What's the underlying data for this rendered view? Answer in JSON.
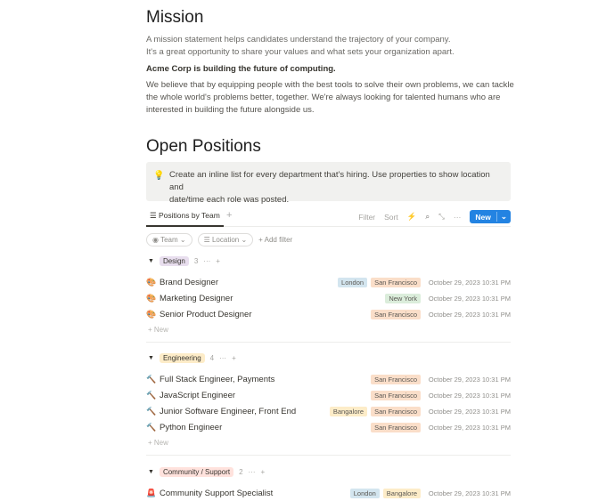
{
  "mission": {
    "title": "Mission",
    "intro": [
      "A mission statement helps candidates understand the trajectory of your company.",
      "It's a great opportunity to share your values and what sets your organization apart."
    ],
    "bold": "Acme Corp is building the future of computing.",
    "body": [
      "We believe that by equipping people with the best tools to solve their own problems, we can tackle",
      "the whole world's problems better, together. We're always looking for talented humans who are",
      "interested in building the future alongside us."
    ]
  },
  "positions": {
    "title": "Open Positions",
    "callout": [
      "Create an inline list for every department that's hiring. Use properties to show location and",
      "date/time each role was posted."
    ],
    "callout_icon": "lightbulb-icon"
  },
  "view": {
    "tab": "Positions by Team",
    "filter": "Filter",
    "sort": "Sort",
    "new": "New",
    "filters": {
      "team": "Team",
      "location": "Location",
      "add": "Add filter"
    }
  },
  "colors": {
    "London": "#d3e5ef",
    "San Francisco": "#fadec9",
    "New York": "#dbeddb",
    "Bangalore": "#fdecc8",
    "Design": "#e8deee",
    "Engineering": "#fdecc8",
    "Community / Support": "#ffe2dd"
  },
  "groups": [
    {
      "name": "Design",
      "count": "3",
      "icon": "🎨",
      "rows": [
        {
          "name": "Brand Designer",
          "tags": [
            "London",
            "San Francisco"
          ],
          "date": "October 29, 2023 10:31 PM"
        },
        {
          "name": "Marketing Designer",
          "tags": [
            "New York"
          ],
          "date": "October 29, 2023 10:31 PM"
        },
        {
          "name": "Senior Product Designer",
          "tags": [
            "San Francisco"
          ],
          "date": "October 29, 2023 10:31 PM"
        }
      ]
    },
    {
      "name": "Engineering",
      "count": "4",
      "icon": "🔨",
      "rows": [
        {
          "name": "Full Stack Engineer, Payments",
          "tags": [
            "San Francisco"
          ],
          "date": "October 29, 2023 10:31 PM"
        },
        {
          "name": "JavaScript Engineer",
          "tags": [
            "San Francisco"
          ],
          "date": "October 29, 2023 10:31 PM"
        },
        {
          "name": "Junior Software Engineer, Front End",
          "tags": [
            "Bangalore",
            "San Francisco"
          ],
          "date": "October 29, 2023 10:31 PM"
        },
        {
          "name": "Python Engineer",
          "tags": [
            "San Francisco"
          ],
          "date": "October 29, 2023 10:31 PM"
        }
      ]
    },
    {
      "name": "Community / Support",
      "count": "2",
      "icon": "🚨",
      "rows": [
        {
          "name": "Community Support Specialist",
          "tags": [
            "London",
            "Bangalore"
          ],
          "date": "October 29, 2023 10:31 PM"
        }
      ]
    }
  ],
  "new_label": "New"
}
